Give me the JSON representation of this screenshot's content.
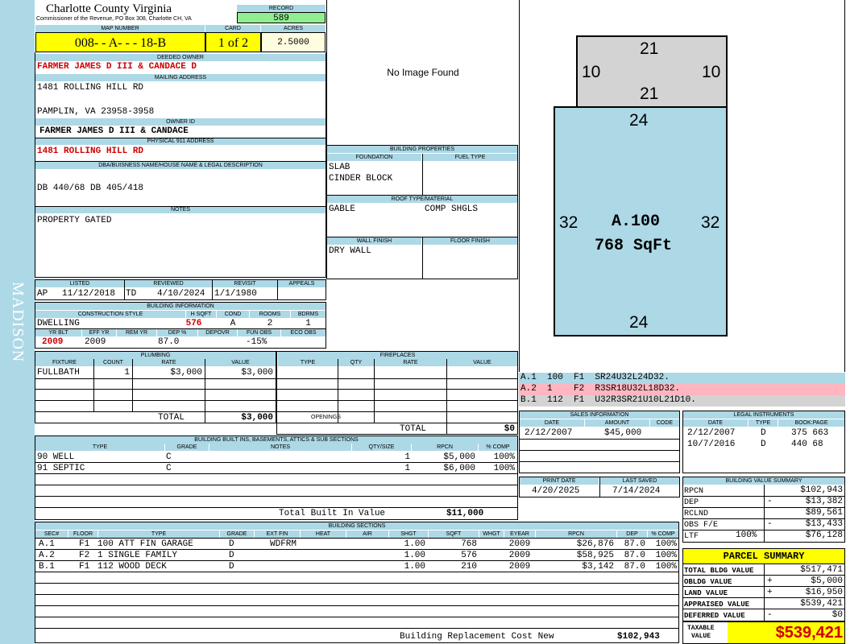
{
  "side_label": "MADISON",
  "county": {
    "title": "Charlotte County Virginia",
    "subtitle": "Commissioner of the Revenue, PO Box 308, Charlotte CH, VA"
  },
  "record": {
    "label": "RECORD",
    "value": "589"
  },
  "map": {
    "map_label": "MAP NUMBER",
    "map_value": "008- - A- - - 18-B",
    "card_label": "CARD",
    "card_value": "1 of 2",
    "acres_label": "ACRES",
    "acres_value": "2.5000"
  },
  "deeded_owner": {
    "label": "DEEDED OWNER",
    "value": "FARMER JAMES D III & CANDACE D"
  },
  "mailing": {
    "label": "MAILING ADDRESS",
    "line1": "1481 ROLLING HILL RD",
    "line2": "PAMPLIN, VA 23958-3958"
  },
  "owner_id": {
    "label": "OWNER ID",
    "value": "FARMER JAMES D III & CANDACE"
  },
  "physical": {
    "label": "PHYSICAL 911 ADDRESS",
    "value": "1481 ROLLING HILL RD"
  },
  "legal": {
    "label": "DBA/BUISNESS NAME/HOUSE NAME & LEGAL DESCRIPTION",
    "value": "DB 440/68 DB 405/418"
  },
  "notes": {
    "label": "NOTES",
    "value": "PROPERTY GATED"
  },
  "image": {
    "text": "No Image Found"
  },
  "building_properties": {
    "label": "BUILDING PROPERTIES",
    "foundation_label": "FOUNDATION",
    "fuel_label": "FUEL TYPE",
    "foundation1": "SLAB",
    "foundation2": "CINDER BLOCK",
    "roof_label": "ROOF TYPE/MATERIAL",
    "roof1": "GABLE",
    "roof2": "COMP SHGLS",
    "wall_label": "WALL FINISH",
    "floor_label": "FLOOR FINISH",
    "wall1": "DRY WALL"
  },
  "listing": {
    "listed_label": "LISTED",
    "reviewed_label": "REVIEWED",
    "revisit_label": "REVISIT",
    "appeals_label": "APPEALS",
    "listed_code": "AP",
    "listed": "11/12/2018",
    "reviewed_code": "TD",
    "reviewed": "4/10/2024",
    "revisit": "1/1/1980"
  },
  "building_info": {
    "label": "BUILDING INFORMATION",
    "style_label": "CONSTRUCTION STYLE",
    "hsqft_label": "H SQFT",
    "cond_label": "COND",
    "rooms_label": "ROOMS",
    "bdrms_label": "BDRMS",
    "style": "DWELLING",
    "hsqft": "576",
    "cond": "A",
    "rooms": "2",
    "bdrms": "1",
    "yrblt_label": "YR BLT",
    "effyr_label": "EFF YR",
    "remyr_label": "REM YR",
    "dep_label": "DEP %",
    "depovr_label": "DEPOVR",
    "funobs_label": "FUN OBS",
    "ecoobs_label": "ECO OBS",
    "yrblt": "2009",
    "effyr": "2009",
    "dep": "87.0",
    "funobs": "-15%"
  },
  "plumbing": {
    "label": "PLUMBING",
    "h1": "FIXTURE",
    "h2": "COUNT",
    "h3": "RATE",
    "h4": "VALUE",
    "fixture": "FULLBATH",
    "count": "1",
    "rate": "$3,000",
    "value": "$3,000",
    "total_label": "TOTAL",
    "total": "$3,000"
  },
  "fireplaces": {
    "label": "FIREPLACES",
    "h1": "TYPE",
    "h2": "QTY",
    "h3": "RATE",
    "h4": "VALUE",
    "openings_label": "OPENINGS",
    "total_label": "TOTAL",
    "total": "$0"
  },
  "builtins": {
    "label": "BUILDING BUILT INS, BASEMENTS, ATTICS & SUB SECTIONS",
    "h_type": "TYPE",
    "h_grade": "GRADE",
    "h_notes": "NOTES",
    "h_qty": "QTY/SIZE",
    "h_rpcn": "RPCN",
    "h_comp": "% COMP",
    "rows": [
      {
        "type": "90 WELL",
        "grade": "C",
        "qty": "1",
        "rpcn": "$5,000",
        "comp": "100%"
      },
      {
        "type": "91 SEPTIC",
        "grade": "C",
        "qty": "1",
        "rpcn": "$6,000",
        "comp": "100%"
      }
    ],
    "total_label": "Total Built In Value",
    "total": "$11,000"
  },
  "sections": {
    "label": "BUILDING SECTIONS",
    "h_sec": "SEC#",
    "h_floor": "FLOOR",
    "h_type": "TYPE",
    "h_grade": "GRADE",
    "h_extfin": "EXT FIN",
    "h_heat": "HEAT",
    "h_air": "AIR",
    "h_shgt": "SHGT",
    "h_sqft": "SQFT",
    "h_whgt": "WHGT",
    "h_eyear": "EYEAR",
    "h_rpcn": "RPCN",
    "h_dep": "DEP",
    "h_comp": "% COMP",
    "rows": [
      {
        "sec": "A.1",
        "floor": "F1",
        "type": "100 ATT FIN GARAGE",
        "grade": "D",
        "extfin": "WDFRM",
        "shgt": "1.00",
        "sqft": "768",
        "eyear": "2009",
        "rpcn": "$26,876",
        "dep": "87.0",
        "comp": "100%"
      },
      {
        "sec": "A.2",
        "floor": "F2",
        "type": "1 SINGLE FAMILY",
        "grade": "D",
        "extfin": "",
        "shgt": "1.00",
        "sqft": "576",
        "eyear": "2009",
        "rpcn": "$58,925",
        "dep": "87.0",
        "comp": "100%"
      },
      {
        "sec": "B.1",
        "floor": "F1",
        "type": "112 WOOD DECK",
        "grade": "D",
        "extfin": "",
        "shgt": "1.00",
        "sqft": "210",
        "eyear": "2009",
        "rpcn": "$3,142",
        "dep": "87.0",
        "comp": "100%"
      }
    ],
    "total_label": "Building Replacement Cost New",
    "total": "$102,943"
  },
  "sketch": {
    "top_dim": "21",
    "left_dim": "10",
    "right_dim": "10",
    "mid_dim": "21",
    "main_top": "24",
    "main_left": "32",
    "main_right": "32",
    "main_bottom": "24",
    "area_label": "A.100",
    "area_sqft": "768 SqFt",
    "fill_gray": "#d3d3d3",
    "fill_blue": "#add8e6"
  },
  "sketch_legend": [
    {
      "text": "A.1  100  F1  SR24U32L24D32.",
      "bg": "#add8e6"
    },
    {
      "text": "A.2  1    F2  R3SR18U32L18D32.",
      "bg": "#ffb6c1"
    },
    {
      "text": "B.1  112  F1  U32R3SR21U10L21D10.",
      "bg": "#d3d3d3"
    }
  ],
  "sales": {
    "label": "SALES INFORMATION",
    "h_date": "DATE",
    "h_amount": "AMOUNT",
    "h_code": "CODE",
    "date": "2/12/2007",
    "amount": "$45,000"
  },
  "legal_instruments": {
    "label": "LEGAL INSTRUMENTS",
    "h_date": "DATE",
    "h_type": "TYPE",
    "h_book": "BOOK:PAGE",
    "rows": [
      {
        "date": "2/12/2007",
        "type": "D",
        "book": "375 663"
      },
      {
        "date": "10/7/2016",
        "type": "D",
        "book": "440 68"
      }
    ]
  },
  "print": {
    "print_label": "PRINT DATE",
    "saved_label": "LAST SAVED",
    "print_date": "4/20/2025",
    "saved_date": "7/14/2024"
  },
  "bvs": {
    "label": "BUILDING VALUE SUMMARY",
    "rows": [
      {
        "k": "RPCN",
        "s": "",
        "v": "$102,943"
      },
      {
        "k": "DEP",
        "s": "-",
        "v": "$13,382"
      },
      {
        "k": "RCLND",
        "s": "",
        "v": "$89,561"
      },
      {
        "k": "OBS F/E",
        "s": "-",
        "v": "$13,433"
      },
      {
        "k": "LTF",
        "pct": "100%",
        "s": "",
        "v": "$76,128"
      }
    ]
  },
  "parcel": {
    "label": "PARCEL SUMMARY",
    "rows": [
      {
        "k": "TOTAL BLDG VALUE",
        "s": "",
        "v": "$517,471"
      },
      {
        "k": "OBLDG VALUE",
        "s": "+",
        "v": "$5,000"
      },
      {
        "k": "LAND VALUE",
        "s": "+",
        "v": "$16,950"
      },
      {
        "k": "APPRAISED VALUE",
        "s": "",
        "v": "$539,421"
      },
      {
        "k": "DEFERRED VALUE",
        "s": "-",
        "v": "$0"
      }
    ],
    "taxable_label1": "TAXABLE",
    "taxable_label2": "VALUE",
    "taxable": "$539,421"
  },
  "colors": {
    "header_blue": "#add8e6",
    "yellow": "#ffff00",
    "green": "#90ee90",
    "red": "#d00000",
    "pink": "#ffb6c1"
  }
}
